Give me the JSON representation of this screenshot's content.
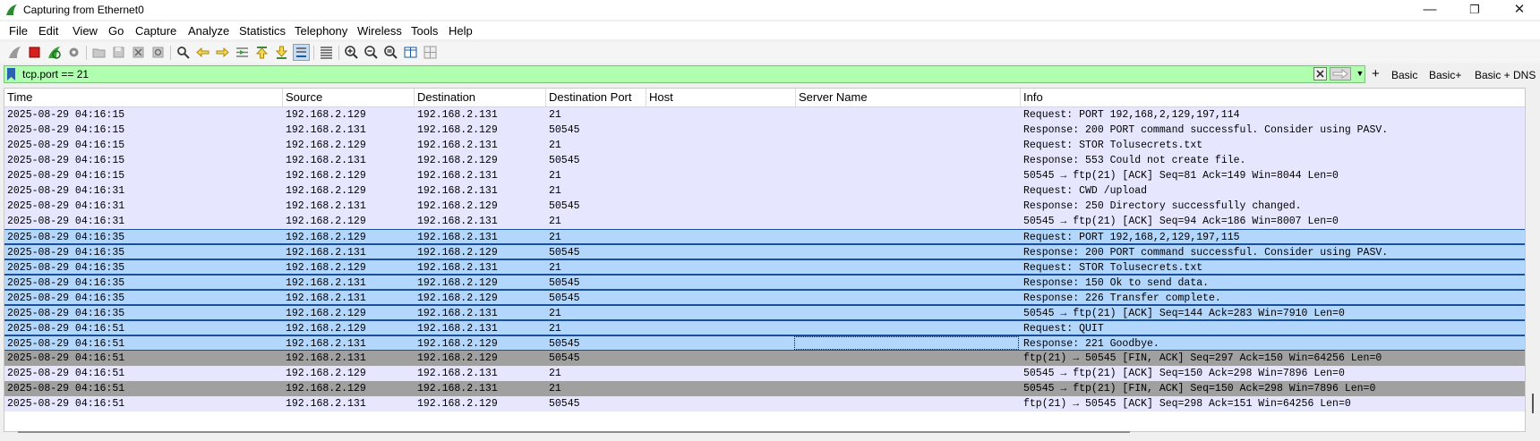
{
  "window": {
    "title": "Capturing from Ethernet0",
    "controls": {
      "minimize": "—",
      "maximize": "❐",
      "close": "✕"
    }
  },
  "menu": [
    "File",
    "Edit",
    "View",
    "Go",
    "Capture",
    "Analyze",
    "Statistics",
    "Telephony",
    "Wireless",
    "Tools",
    "Help"
  ],
  "toolbar": {
    "icons": [
      "shark-fin-start-icon",
      "stop-icon",
      "restart-icon",
      "options-gear-icon",
      "open-folder-icon",
      "save-icon",
      "close-file-icon",
      "reload-icon",
      "find-icon",
      "go-back-icon",
      "go-forward-icon",
      "go-to-packet-icon",
      "first-packet-icon",
      "last-packet-icon",
      "autoscroll-icon",
      "colorize-icon",
      "zoom-in-icon",
      "zoom-out-icon",
      "normal-size-icon",
      "resize-columns-icon",
      "layout-icon"
    ]
  },
  "filter": {
    "value": "tcp.port == 21",
    "plus": "+",
    "buttons": [
      "Basic",
      "Basic+",
      "Basic + DNS"
    ],
    "colors": {
      "valid_bg": "#afffaf"
    }
  },
  "packets": {
    "columns": [
      "Time",
      "Source",
      "Destination",
      "Destination Port",
      "Host",
      "Server Name",
      "Info"
    ],
    "rows": [
      {
        "time": "2025-08-29 04:16:15",
        "src": "192.168.2.129",
        "dst": "192.168.2.131",
        "port": "21",
        "host": "",
        "server": "",
        "info": "Request: PORT 192,168,2,129,197,114",
        "color": "normal"
      },
      {
        "time": "2025-08-29 04:16:15",
        "src": "192.168.2.131",
        "dst": "192.168.2.129",
        "port": "50545",
        "host": "",
        "server": "",
        "info": "Response: 200 PORT command successful. Consider using PASV.",
        "color": "normal"
      },
      {
        "time": "2025-08-29 04:16:15",
        "src": "192.168.2.129",
        "dst": "192.168.2.131",
        "port": "21",
        "host": "",
        "server": "",
        "info": "Request: STOR Tolusecrets.txt",
        "color": "normal"
      },
      {
        "time": "2025-08-29 04:16:15",
        "src": "192.168.2.131",
        "dst": "192.168.2.129",
        "port": "50545",
        "host": "",
        "server": "",
        "info": "Response: 553 Could not create file.",
        "color": "normal"
      },
      {
        "time": "2025-08-29 04:16:15",
        "src": "192.168.2.129",
        "dst": "192.168.2.131",
        "port": "21",
        "host": "",
        "server": "",
        "info": "50545 → ftp(21) [ACK] Seq=81 Ack=149 Win=8044 Len=0",
        "color": "normal"
      },
      {
        "time": "2025-08-29 04:16:31",
        "src": "192.168.2.129",
        "dst": "192.168.2.131",
        "port": "21",
        "host": "",
        "server": "",
        "info": "Request: CWD /upload",
        "color": "normal"
      },
      {
        "time": "2025-08-29 04:16:31",
        "src": "192.168.2.131",
        "dst": "192.168.2.129",
        "port": "50545",
        "host": "",
        "server": "",
        "info": "Response: 250 Directory successfully changed.",
        "color": "normal"
      },
      {
        "time": "2025-08-29 04:16:31",
        "src": "192.168.2.129",
        "dst": "192.168.2.131",
        "port": "21",
        "host": "",
        "server": "",
        "info": "50545 → ftp(21) [ACK] Seq=94 Ack=186 Win=8007 Len=0",
        "color": "normal"
      },
      {
        "time": "2025-08-29 04:16:35",
        "src": "192.168.2.129",
        "dst": "192.168.2.131",
        "port": "21",
        "host": "",
        "server": "",
        "info": "Request: PORT 192,168,2,129,197,115",
        "color": "sel"
      },
      {
        "time": "2025-08-29 04:16:35",
        "src": "192.168.2.131",
        "dst": "192.168.2.129",
        "port": "50545",
        "host": "",
        "server": "",
        "info": "Response: 200 PORT command successful. Consider using PASV.",
        "color": "sel"
      },
      {
        "time": "2025-08-29 04:16:35",
        "src": "192.168.2.129",
        "dst": "192.168.2.131",
        "port": "21",
        "host": "",
        "server": "",
        "info": "Request: STOR Tolusecrets.txt",
        "color": "sel"
      },
      {
        "time": "2025-08-29 04:16:35",
        "src": "192.168.2.131",
        "dst": "192.168.2.129",
        "port": "50545",
        "host": "",
        "server": "",
        "info": "Response: 150 Ok to send data.",
        "color": "sel"
      },
      {
        "time": "2025-08-29 04:16:35",
        "src": "192.168.2.131",
        "dst": "192.168.2.129",
        "port": "50545",
        "host": "",
        "server": "",
        "info": "Response: 226 Transfer complete.",
        "color": "sel"
      },
      {
        "time": "2025-08-29 04:16:35",
        "src": "192.168.2.129",
        "dst": "192.168.2.131",
        "port": "21",
        "host": "",
        "server": "",
        "info": "50545 → ftp(21) [ACK] Seq=144 Ack=283 Win=7910 Len=0",
        "color": "sel"
      },
      {
        "time": "2025-08-29 04:16:51",
        "src": "192.168.2.129",
        "dst": "192.168.2.131",
        "port": "21",
        "host": "",
        "server": "",
        "info": "Request: QUIT",
        "color": "sel"
      },
      {
        "time": "2025-08-29 04:16:51",
        "src": "192.168.2.131",
        "dst": "192.168.2.129",
        "port": "50545",
        "host": "",
        "server": "",
        "info": "Response: 221 Goodbye.",
        "color": "sel",
        "focus": true
      },
      {
        "time": "2025-08-29 04:16:51",
        "src": "192.168.2.131",
        "dst": "192.168.2.129",
        "port": "50545",
        "host": "",
        "server": "",
        "info": "ftp(21) → 50545 [FIN, ACK] Seq=297 Ack=150 Win=64256 Len=0",
        "color": "gray"
      },
      {
        "time": "2025-08-29 04:16:51",
        "src": "192.168.2.129",
        "dst": "192.168.2.131",
        "port": "21",
        "host": "",
        "server": "",
        "info": "50545 → ftp(21) [ACK] Seq=150 Ack=298 Win=7896 Len=0",
        "color": "normal"
      },
      {
        "time": "2025-08-29 04:16:51",
        "src": "192.168.2.129",
        "dst": "192.168.2.131",
        "port": "21",
        "host": "",
        "server": "",
        "info": "50545 → ftp(21) [FIN, ACK] Seq=150 Ack=298 Win=7896 Len=0",
        "color": "gray"
      },
      {
        "time": "2025-08-29 04:16:51",
        "src": "192.168.2.131",
        "dst": "192.168.2.129",
        "port": "50545",
        "host": "",
        "server": "",
        "info": "ftp(21) → 50545 [ACK] Seq=298 Ack=151 Win=64256 Len=0",
        "color": "normal"
      }
    ],
    "row_colors": {
      "normal": "#e7e6ff",
      "sel": "#b3d6fd",
      "gray": "#a0a0a0"
    }
  }
}
